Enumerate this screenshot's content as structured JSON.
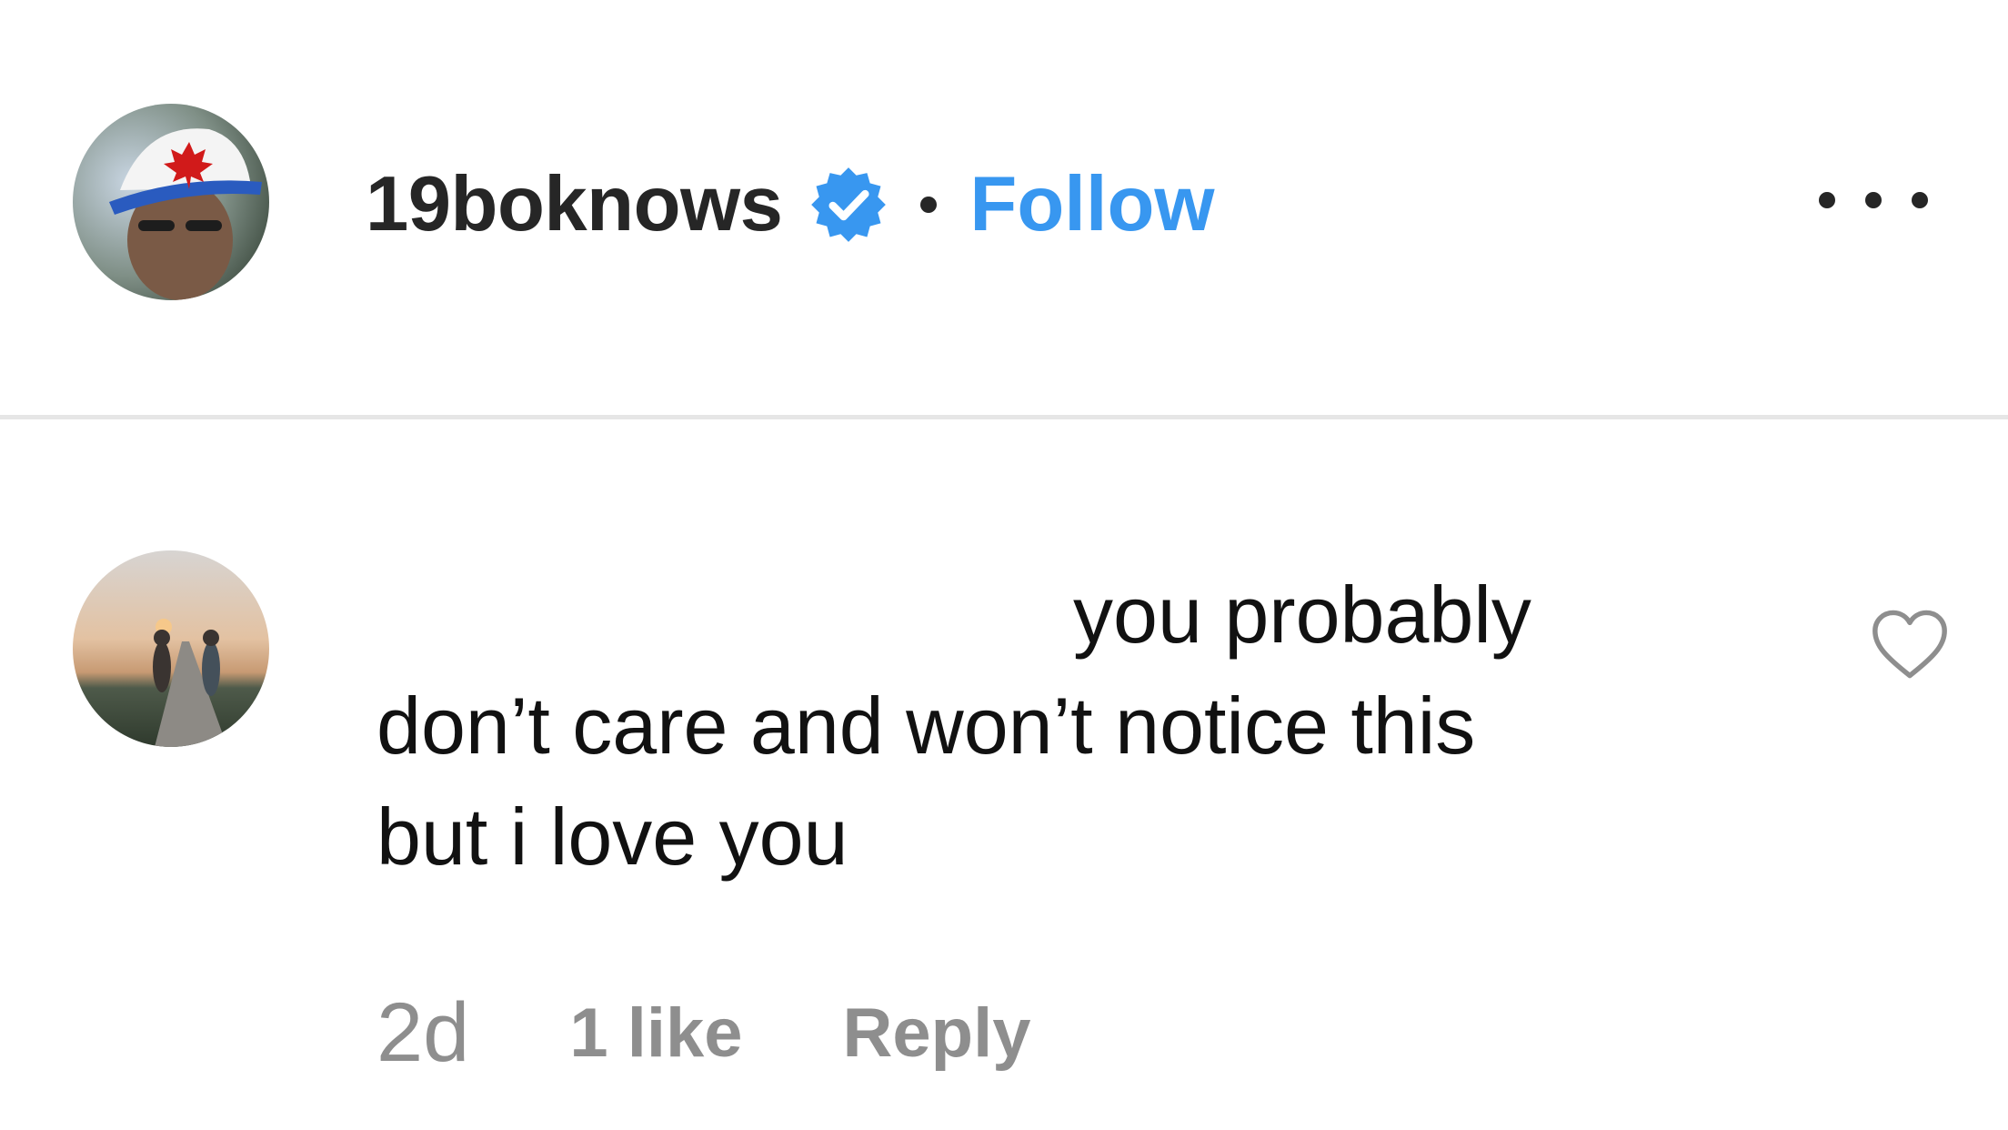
{
  "post_header": {
    "username": "19boknows",
    "verified": true,
    "verified_icon": "verified-badge-icon",
    "separator": "•",
    "follow_label": "Follow",
    "more_icon": "more-options-icon"
  },
  "comment": {
    "text_lines": [
      "you probably",
      "don’t care and won’t notice this",
      "but i love you"
    ],
    "timestamp": "2d",
    "likes_label": "1 like",
    "reply_label": "Reply",
    "like_icon": "heart-outline-icon"
  },
  "colors": {
    "accent": "#3897f0",
    "text": "#262626",
    "muted": "#8e8e8e",
    "divider": "#e6e6e6"
  }
}
